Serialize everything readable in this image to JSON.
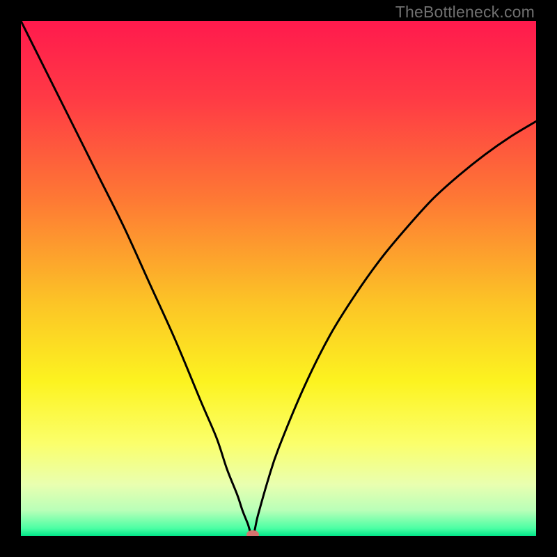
{
  "watermark": "TheBottleneck.com",
  "chart_data": {
    "type": "line",
    "title": "",
    "xlabel": "",
    "ylabel": "",
    "xlim": [
      0,
      100
    ],
    "ylim": [
      0,
      100
    ],
    "grid": false,
    "legend": false,
    "background_gradient_stops": [
      {
        "offset": 0.0,
        "color": "#ff1a4d"
      },
      {
        "offset": 0.15,
        "color": "#ff3a45"
      },
      {
        "offset": 0.35,
        "color": "#fe7a34"
      },
      {
        "offset": 0.55,
        "color": "#fcc526"
      },
      {
        "offset": 0.7,
        "color": "#fcf320"
      },
      {
        "offset": 0.82,
        "color": "#fbff6b"
      },
      {
        "offset": 0.9,
        "color": "#e9ffb0"
      },
      {
        "offset": 0.95,
        "color": "#b9ffb8"
      },
      {
        "offset": 0.985,
        "color": "#4bffa4"
      },
      {
        "offset": 1.0,
        "color": "#00e588"
      }
    ],
    "marker": {
      "x": 45,
      "y": 0,
      "color": "#d6736f"
    },
    "series": [
      {
        "name": "curve",
        "x": [
          0,
          5,
          10,
          15,
          20,
          25,
          30,
          35,
          38,
          40,
          42,
          43,
          44,
          45,
          46,
          48,
          50,
          55,
          60,
          65,
          70,
          75,
          80,
          85,
          90,
          95,
          100
        ],
        "y": [
          100,
          90,
          80,
          70,
          60,
          49,
          38,
          26,
          19,
          13,
          8,
          5,
          2.5,
          0,
          4,
          11,
          17,
          29,
          39,
          47,
          54,
          60,
          65.5,
          70,
          74,
          77.5,
          80.5
        ]
      }
    ]
  }
}
